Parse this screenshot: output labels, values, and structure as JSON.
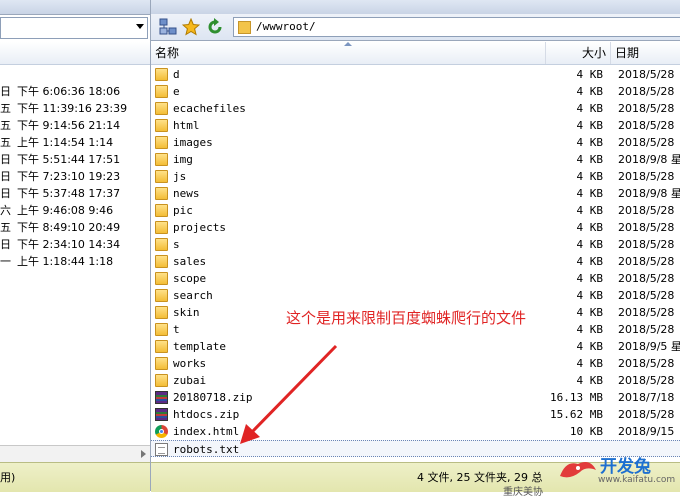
{
  "left_pane": {
    "rows": [
      {
        "day": "日",
        "time": "下午 6:06:36 18:06"
      },
      {
        "day": "五",
        "time": "下午 11:39:16 23:39"
      },
      {
        "day": "五",
        "time": "下午 9:14:56 21:14"
      },
      {
        "day": "五",
        "time": "上午 1:14:54 1:14"
      },
      {
        "day": "日",
        "time": "下午 5:51:44 17:51"
      },
      {
        "day": "日",
        "time": "下午 7:23:10 19:23"
      },
      {
        "day": "日",
        "time": "下午 5:37:48 17:37"
      },
      {
        "day": "六",
        "time": "上午 9:46:08 9:46"
      },
      {
        "day": "五",
        "time": "下午 8:49:10 20:49"
      },
      {
        "day": "日",
        "time": "下午 2:34:10 14:34"
      },
      {
        "day": "一",
        "time": "上午 1:18:44 1:18"
      }
    ],
    "status": "用)"
  },
  "toolbar": {
    "icons": [
      "network-icon",
      "star-icon",
      "refresh-icon",
      "folder-icon"
    ],
    "path": "/wwwroot/"
  },
  "columns": {
    "name": "名称",
    "size": "大小",
    "date": "日期"
  },
  "files": [
    {
      "name": "d",
      "size": "4 KB",
      "date": "2018/5/28",
      "icon": "folder"
    },
    {
      "name": "e",
      "size": "4 KB",
      "date": "2018/5/28",
      "icon": "folder"
    },
    {
      "name": "ecachefiles",
      "size": "4 KB",
      "date": "2018/5/28",
      "icon": "folder"
    },
    {
      "name": "html",
      "size": "4 KB",
      "date": "2018/5/28",
      "icon": "folder"
    },
    {
      "name": "images",
      "size": "4 KB",
      "date": "2018/5/28",
      "icon": "folder"
    },
    {
      "name": "img",
      "size": "4 KB",
      "date": "2018/9/8 星",
      "icon": "folder"
    },
    {
      "name": "js",
      "size": "4 KB",
      "date": "2018/5/28",
      "icon": "folder"
    },
    {
      "name": "news",
      "size": "4 KB",
      "date": "2018/9/8 星",
      "icon": "folder"
    },
    {
      "name": "pic",
      "size": "4 KB",
      "date": "2018/5/28",
      "icon": "folder"
    },
    {
      "name": "projects",
      "size": "4 KB",
      "date": "2018/5/28",
      "icon": "folder"
    },
    {
      "name": "s",
      "size": "4 KB",
      "date": "2018/5/28",
      "icon": "folder"
    },
    {
      "name": "sales",
      "size": "4 KB",
      "date": "2018/5/28",
      "icon": "folder"
    },
    {
      "name": "scope",
      "size": "4 KB",
      "date": "2018/5/28",
      "icon": "folder"
    },
    {
      "name": "search",
      "size": "4 KB",
      "date": "2018/5/28",
      "icon": "folder"
    },
    {
      "name": "skin",
      "size": "4 KB",
      "date": "2018/5/28",
      "icon": "folder"
    },
    {
      "name": "t",
      "size": "4 KB",
      "date": "2018/5/28",
      "icon": "folder"
    },
    {
      "name": "template",
      "size": "4 KB",
      "date": "2018/9/5 星",
      "icon": "folder"
    },
    {
      "name": "works",
      "size": "4 KB",
      "date": "2018/5/28",
      "icon": "folder"
    },
    {
      "name": "zubai",
      "size": "4 KB",
      "date": "2018/5/28",
      "icon": "folder"
    },
    {
      "name": "20180718.zip",
      "size": "16.13 MB",
      "date": "2018/7/18",
      "icon": "zip"
    },
    {
      "name": "htdocs.zip",
      "size": "15.62 MB",
      "date": "2018/5/28",
      "icon": "zip"
    },
    {
      "name": "index.html",
      "size": "10 KB",
      "date": "2018/9/15",
      "icon": "chrome"
    },
    {
      "name": "robots.txt",
      "size": "",
      "date": "",
      "icon": "txt",
      "selected": true
    }
  ],
  "annotation": "这个是用来限制百度蜘蛛爬行的文件",
  "status": {
    "summary": "4 文件, 25 文件夹, 29 总",
    "sub": "重庆美协"
  },
  "watermark": {
    "title": "开发兔",
    "url": "www.kaifatu.com"
  },
  "colors": {
    "annotation": "#e02424",
    "status_bg": "#e7eab8",
    "folder": "#f3c44a"
  }
}
